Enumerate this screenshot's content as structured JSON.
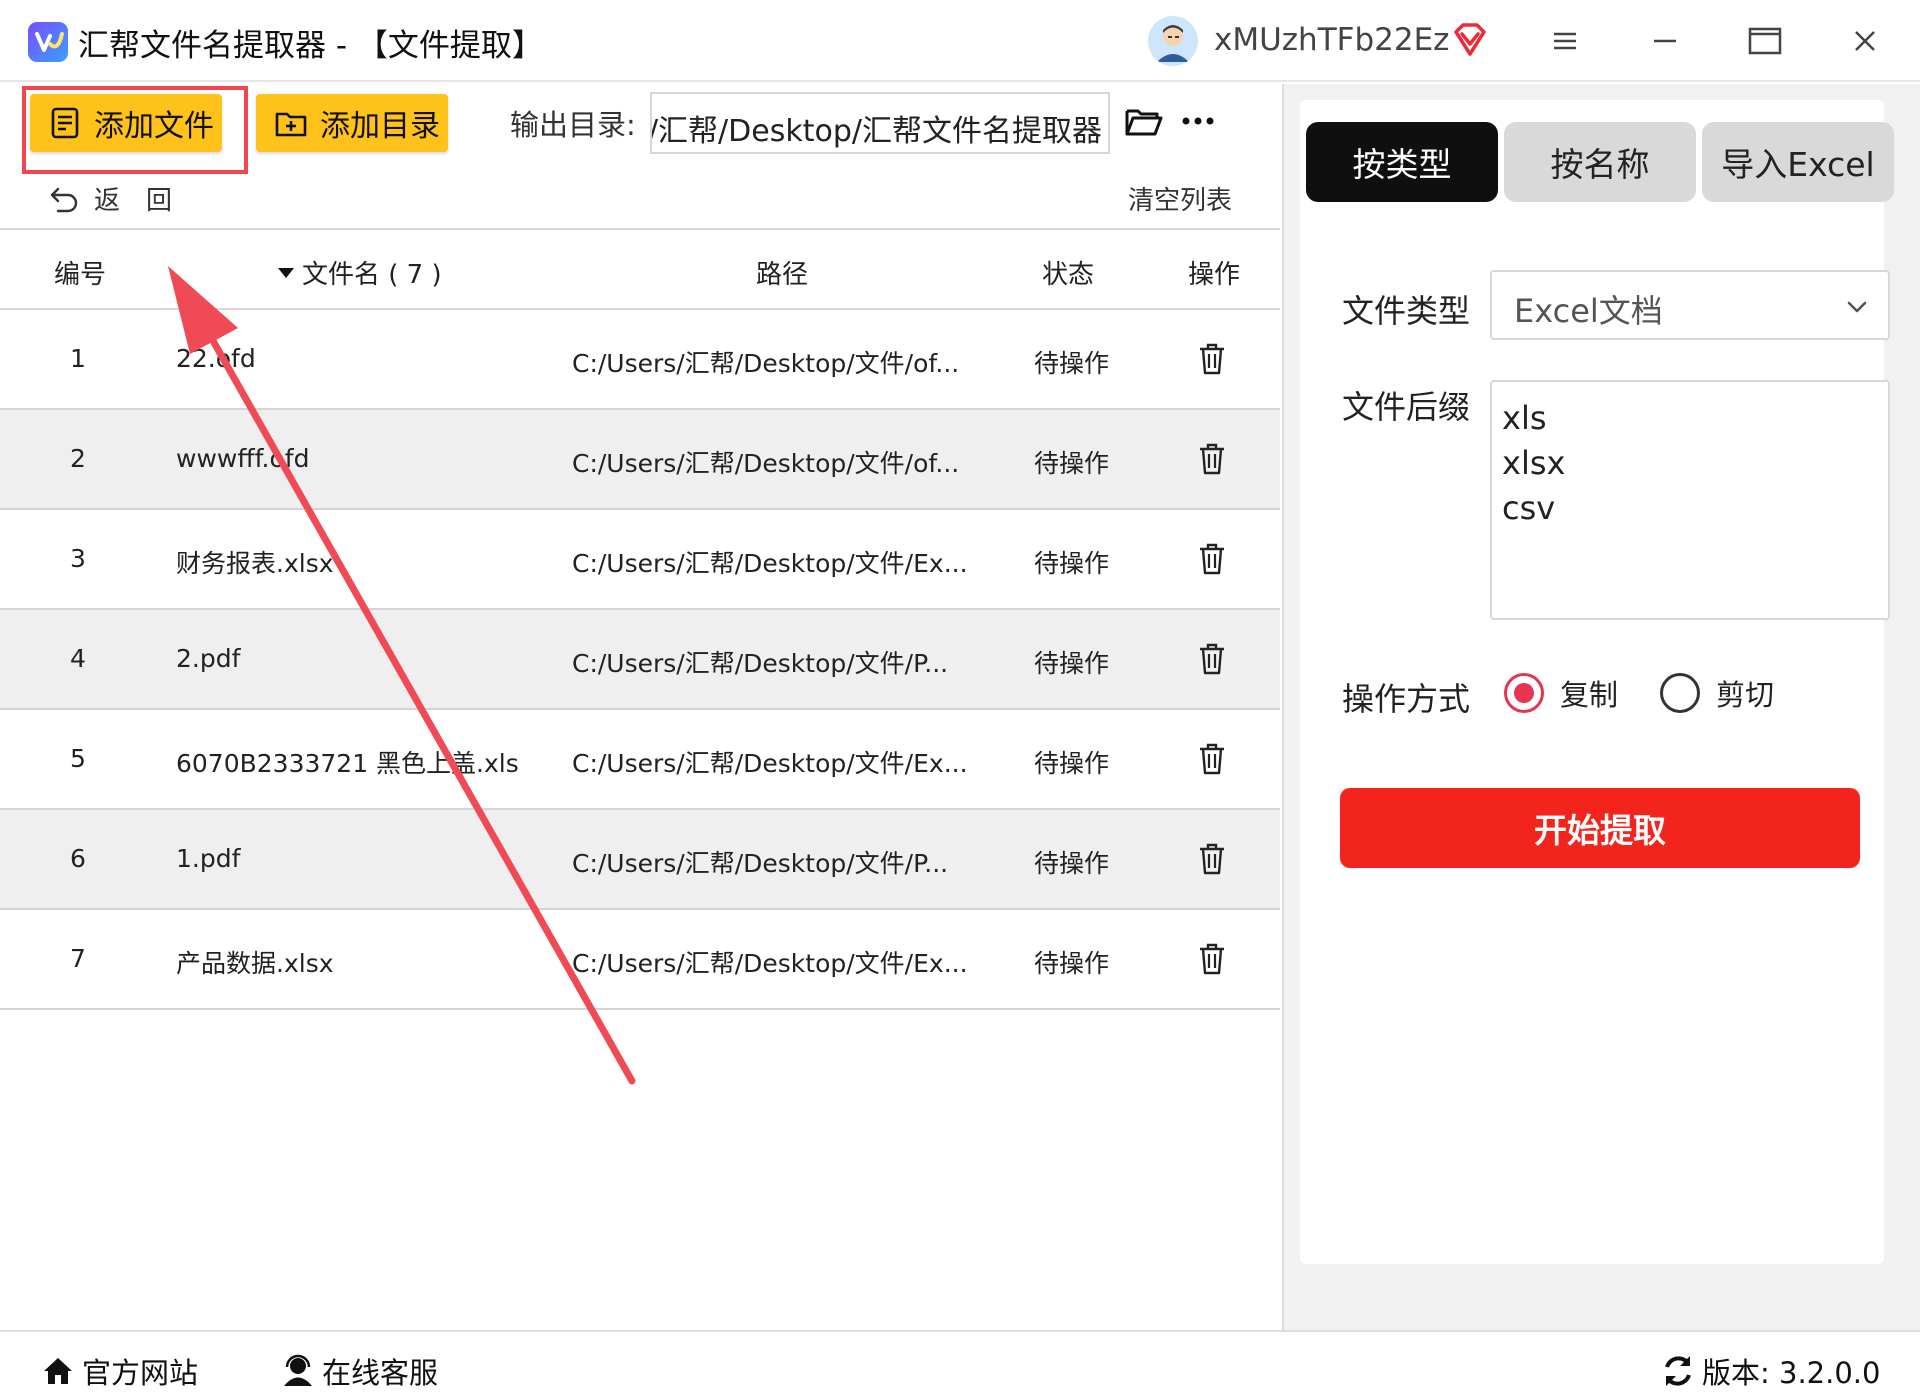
{
  "window": {
    "title": "汇帮文件名提取器 - 【文件提取】",
    "username": "xMUzhTFb22Ez"
  },
  "toolbar": {
    "add_file_label": "添加文件",
    "add_dir_label": "添加目录",
    "output_label": "输出目录:",
    "output_path": "C:/Users/汇帮/Desktop/汇帮文件名提取器",
    "back_label": "返回",
    "clear_label": "清空列表"
  },
  "table": {
    "headers": {
      "no": "编号",
      "name": "文件名 ( 7 )",
      "path": "路径",
      "status": "状态",
      "op": "操作"
    },
    "rows": [
      {
        "no": "1",
        "name": "22.ofd",
        "path": "C:/Users/汇帮/Desktop/文件/of...",
        "status": "待操作"
      },
      {
        "no": "2",
        "name": "wwwfff.ofd",
        "path": "C:/Users/汇帮/Desktop/文件/of...",
        "status": "待操作"
      },
      {
        "no": "3",
        "name": "财务报表.xlsx",
        "path": "C:/Users/汇帮/Desktop/文件/Ex...",
        "status": "待操作"
      },
      {
        "no": "4",
        "name": "2.pdf",
        "path": "C:/Users/汇帮/Desktop/文件/P...",
        "status": "待操作"
      },
      {
        "no": "5",
        "name": "6070B2333721 黑色上盖.xls",
        "path": "C:/Users/汇帮/Desktop/文件/Ex...",
        "status": "待操作"
      },
      {
        "no": "6",
        "name": "1.pdf",
        "path": "C:/Users/汇帮/Desktop/文件/P...",
        "status": "待操作"
      },
      {
        "no": "7",
        "name": "产品数据.xlsx",
        "path": "C:/Users/汇帮/Desktop/文件/Ex...",
        "status": "待操作"
      }
    ]
  },
  "right": {
    "tabs": {
      "by_type": "按类型",
      "by_name": "按名称",
      "import_excel": "导入Excel"
    },
    "file_type_label": "文件类型",
    "file_type_value": "Excel文档",
    "suffix_label": "文件后缀",
    "suffixes": [
      "xls",
      "xlsx",
      "csv"
    ],
    "op_mode_label": "操作方式",
    "op_copy": "复制",
    "op_cut": "剪切",
    "start_label": "开始提取"
  },
  "footer": {
    "site": "官方网站",
    "service": "在线客服",
    "version": "版本: 3.2.0.0"
  },
  "colors": {
    "accent_yellow": "#ffc21a",
    "start_red": "#f3241c",
    "radio_red": "#e63452",
    "annotation_red": "#f2454c",
    "tab_active": "#0f0f0f"
  }
}
